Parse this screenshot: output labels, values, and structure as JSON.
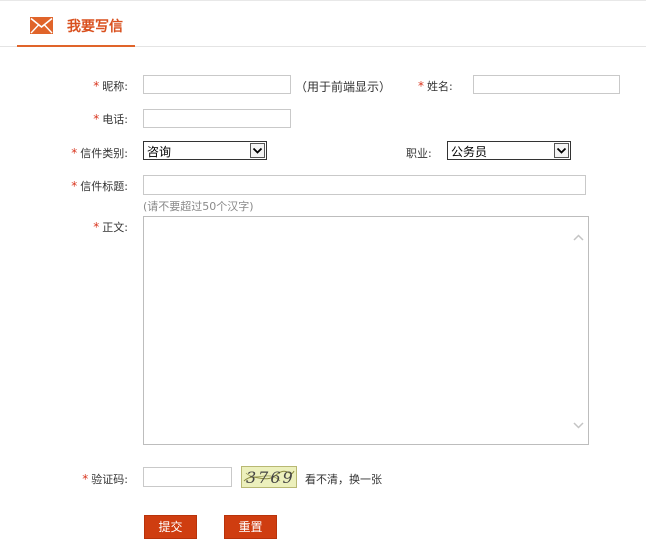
{
  "header": {
    "title": "我要写信",
    "icon": "mail-icon",
    "accent_color": "#e0642a"
  },
  "form": {
    "required_mark": "*",
    "nickname": {
      "label": "昵称:",
      "value": "",
      "note": "（用于前端显示）"
    },
    "name": {
      "label": "姓名:",
      "value": ""
    },
    "phone": {
      "label": "电话:",
      "value": ""
    },
    "letter_type": {
      "label": "信件类别:",
      "selected": "咨询"
    },
    "occupation": {
      "label": "职业:",
      "selected": "公务员"
    },
    "letter_title": {
      "label": "信件标题:",
      "value": "",
      "hint": "(请不要超过50个汉字)"
    },
    "body": {
      "label": "正文:",
      "value": ""
    },
    "captcha": {
      "label": "验证码:",
      "value": "",
      "image_text": "3769",
      "refresh_text": "看不清，换一张"
    }
  },
  "buttons": {
    "submit": "提交",
    "reset": "重置",
    "color": "#cf3d10"
  }
}
